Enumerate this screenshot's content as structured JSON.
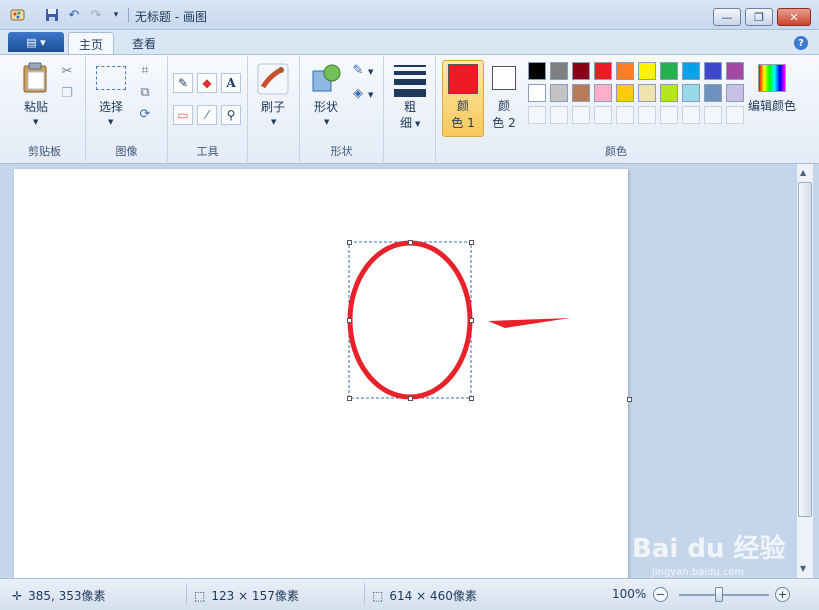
{
  "window": {
    "title": "无标题 - 画图",
    "minimize": "—",
    "restore": "❐",
    "close": "✕"
  },
  "tabs": {
    "menu_button": "▤ ▾",
    "items": [
      {
        "label": "主页"
      },
      {
        "label": "查看"
      }
    ],
    "help": "?"
  },
  "ribbon": {
    "clipboard": {
      "paste": "粘贴",
      "group": "剪贴板"
    },
    "image": {
      "select": "选择",
      "group": "图像"
    },
    "tools": {
      "group": "工具",
      "text_tool": "A"
    },
    "brushes": {
      "label": "刷子"
    },
    "shapes": {
      "label": "形状",
      "group": "形状"
    },
    "size": {
      "label_line1": "粗",
      "label_line2": "细"
    },
    "color1": {
      "line1": "颜",
      "line2": "色 1",
      "value": "#ed1c24"
    },
    "color2": {
      "line1": "颜",
      "line2": "色 2",
      "value": "#ffffff"
    },
    "colors_group": "颜色",
    "edit_colors": "编辑颜色",
    "palette_row1": [
      "#000000",
      "#7f7f7f",
      "#880015",
      "#ed1c24",
      "#ff7f27",
      "#fff200",
      "#22b14c",
      "#00a2e8",
      "#3f48cc",
      "#a349a4"
    ],
    "palette_row2": [
      "#ffffff",
      "#c3c3c3",
      "#b97a57",
      "#ffaec9",
      "#ffc90e",
      "#efe4b0",
      "#b5e61d",
      "#99d9ea",
      "#7092be",
      "#c8bfe7"
    ]
  },
  "drawing": {
    "ellipse_color": "#e8212b",
    "arrow_color": "#e8212b"
  },
  "status": {
    "cursor_pos": "385, 353像素",
    "selection_size": "123 × 157像素",
    "canvas_size": "614 × 460像素",
    "zoom": "100%",
    "zoom_out": "−",
    "zoom_in": "+"
  },
  "watermark": {
    "brand": "Bai du 经验",
    "url": "jingyan.baidu.com"
  }
}
